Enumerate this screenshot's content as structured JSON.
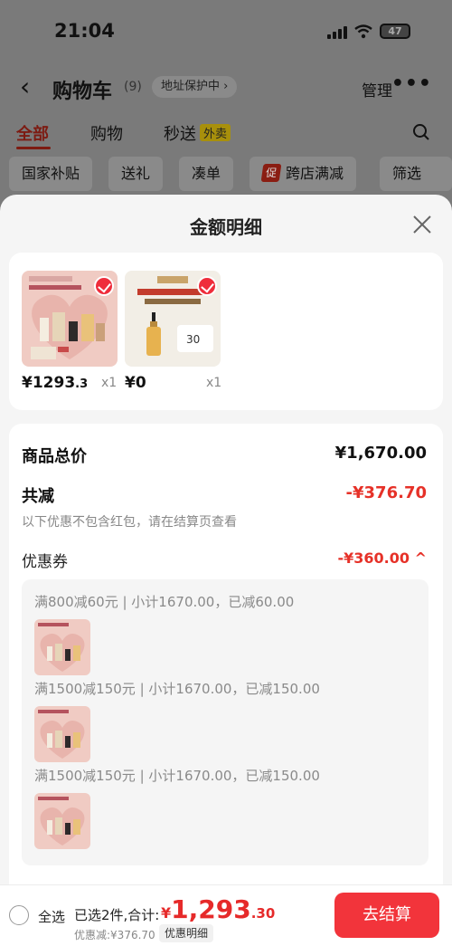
{
  "status_bar": {
    "time": "21:04",
    "battery": "47"
  },
  "nav": {
    "title": "购物车",
    "count": "(9)",
    "address_tag": "地址保护中 ›",
    "manage": "管理",
    "more": "•••"
  },
  "tabs": [
    {
      "label": "全部"
    },
    {
      "label": "购物"
    },
    {
      "label": "秒送"
    }
  ],
  "waimai_badge": "外卖",
  "chips": [
    {
      "label": "国家补贴"
    },
    {
      "label": "送礼"
    },
    {
      "label": "凑单"
    },
    {
      "label": "跨店满减"
    },
    {
      "label": "筛选"
    }
  ],
  "chip_badge": "促",
  "sheet": {
    "title": "金额明细",
    "products": [
      {
        "price_main": "¥1293",
        "price_dec": ".3",
        "qty": "x1",
        "image": "ysl-gift-box"
      },
      {
        "price_main": "¥0",
        "price_dec": "",
        "qty": "x1",
        "image": "camellia-serum"
      }
    ],
    "total_label": "商品总价",
    "total_value": "¥1,670.00",
    "reduce_label": "共减",
    "reduce_value": "-¥376.70",
    "note": "以下优惠不包含红包，请在结算页查看",
    "coupon_label": "优惠券",
    "coupon_value": "-¥360.00 ^",
    "coupon_rows": [
      {
        "text": "满800减60元 | 小计1670.00，已减60.00"
      },
      {
        "text": "满1500减150元 | 小计1670.00，已减150.00"
      },
      {
        "text": "满1500减150元 | 小计1670.00，已减150.00"
      }
    ]
  },
  "bottom": {
    "select_all": "全选",
    "selected_text": "已选2件,合计:",
    "total_yen": "¥",
    "total_int": "1,293",
    "total_dec": ".30",
    "discount_text": "优惠减:¥376.70",
    "detail_button": "优惠明细",
    "checkout_button": "去结算"
  },
  "colors": {
    "accent_red": "#e63128",
    "checkout_red": "#f2343b"
  }
}
